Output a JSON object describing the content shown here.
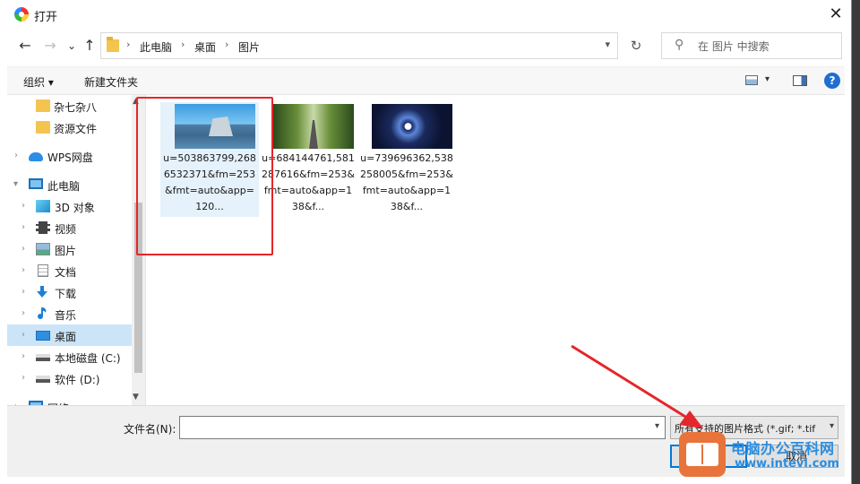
{
  "window": {
    "title": "打开",
    "close": "✕"
  },
  "nav": {
    "back": "←",
    "forward": "→",
    "recent": "⌄",
    "up": "↑",
    "breadcrumbs": [
      "此电脑",
      "桌面",
      "图片"
    ],
    "crumb_sep": "›",
    "refresh": "↻"
  },
  "search": {
    "placeholder": "在 图片 中搜索",
    "icon": "⚲"
  },
  "toolbar": {
    "organize": "组织 ▾",
    "new_folder": "新建文件夹",
    "view_dd": "▾",
    "help": "?"
  },
  "sidebar": {
    "items": [
      {
        "label": "杂七杂八",
        "icon": "folder-icon"
      },
      {
        "label": "资源文件",
        "icon": "folder-icon"
      },
      {
        "label": "WPS网盘",
        "icon": "cloud-icon"
      },
      {
        "label": "此电脑",
        "icon": "computer-icon"
      },
      {
        "label": "3D 对象",
        "icon": "cube-icon"
      },
      {
        "label": "视频",
        "icon": "film-icon"
      },
      {
        "label": "图片",
        "icon": "picture-icon"
      },
      {
        "label": "文档",
        "icon": "document-icon"
      },
      {
        "label": "下载",
        "icon": "download-icon"
      },
      {
        "label": "音乐",
        "icon": "music-icon"
      },
      {
        "label": "桌面",
        "icon": "desktop-icon",
        "selected": true
      },
      {
        "label": "本地磁盘 (C:)",
        "icon": "drive-icon"
      },
      {
        "label": "软件 (D:)",
        "icon": "drive-icon"
      },
      {
        "label": "网络",
        "icon": "network-icon"
      }
    ]
  },
  "files": [
    {
      "name": "u=503863799,2686532371&fm=253&fmt=auto&app=120...",
      "selected": true
    },
    {
      "name": "u=684144761,581287616&fm=253&fmt=auto&app=138&f..."
    },
    {
      "name": "u=739696362,538258005&fm=253&fmt=auto&app=138&f..."
    }
  ],
  "bottom": {
    "filename_label": "文件名(N):",
    "filename_value": "",
    "filter": "所有支持的图片格式 (*.gif; *.tif",
    "open": "",
    "cancel": "取消"
  },
  "watermark": {
    "line1": "电脑办公百科网",
    "line2": "www.intevl.com"
  },
  "colors": {
    "accent": "#0078d7",
    "highlight_red": "#e5262a",
    "selection": "#cce4f7"
  }
}
